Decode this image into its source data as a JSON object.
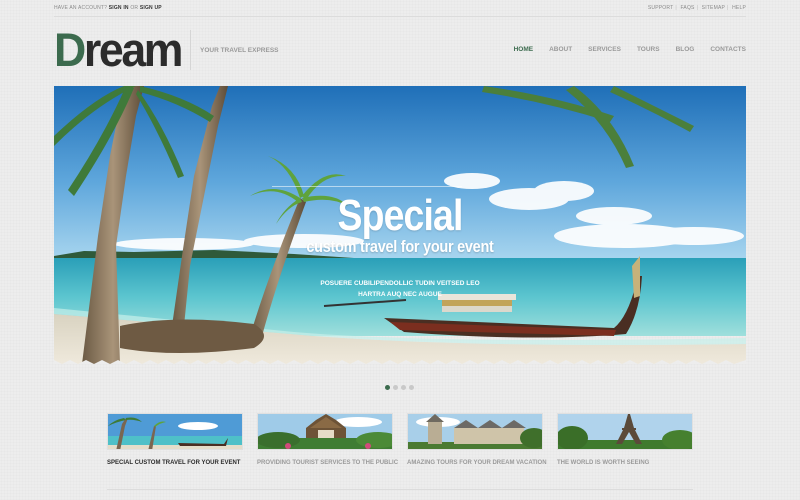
{
  "topbar": {
    "account_prompt": "Have an account?",
    "sign_in": "Sign In",
    "or": "or",
    "sign_up": "Sign Up",
    "links": [
      "Support",
      "FAQs",
      "Sitemap",
      "Help"
    ]
  },
  "brand": {
    "logo_first": "D",
    "logo_rest": "ream",
    "tagline": "Your Travel Express",
    "accent_color": "#3c6b4e"
  },
  "nav": {
    "items": [
      "Home",
      "About",
      "Services",
      "Tours",
      "Blog",
      "Contacts"
    ],
    "active": "Home"
  },
  "hero": {
    "title": "Special",
    "subtitle": "custom travel for your event",
    "description": "Posuere cubilipendollic tudin veitsed leo hartra auq nec augue"
  },
  "slider": {
    "dot_count": 4,
    "active_index": 0
  },
  "thumbnails": [
    {
      "caption": "Special custom travel for your event",
      "icon": "beach-thumbnail",
      "highlighted": true
    },
    {
      "caption": "Providing tourist services to the public",
      "icon": "temple-thumbnail",
      "highlighted": false
    },
    {
      "caption": "Amazing tours for your dream vacation",
      "icon": "castle-thumbnail",
      "highlighted": false
    },
    {
      "caption": "The world is worth seeing",
      "icon": "eiffel-tower-thumbnail",
      "highlighted": false
    }
  ]
}
